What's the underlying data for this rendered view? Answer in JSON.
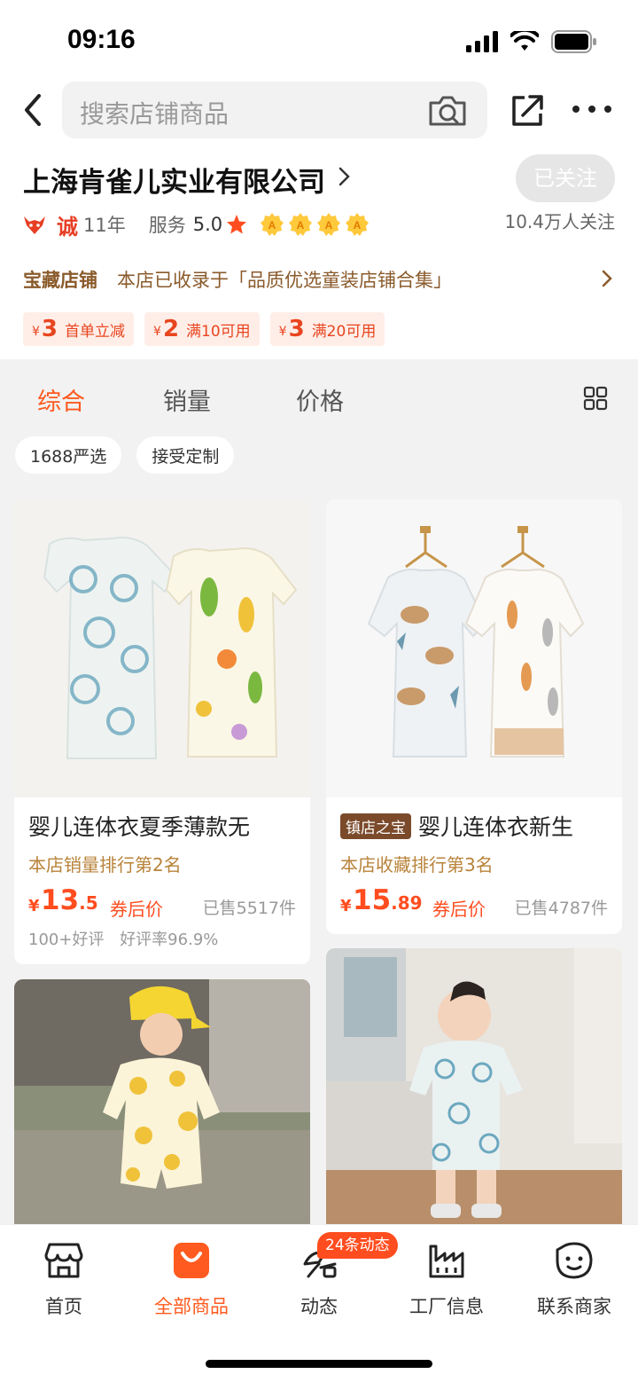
{
  "status_bar": {
    "time": "09:16"
  },
  "search": {
    "placeholder": "搜索店铺商品"
  },
  "shop": {
    "name": "上海肯雀儿实业有限公司",
    "follow_label": "已关注",
    "followers": "10.4万人关注",
    "cheng_label": "诚",
    "years": "11年",
    "service_label": "服务",
    "service_score": "5.0",
    "badge_letter": "A",
    "treasure_label": "宝藏店铺",
    "treasure_desc": "本店已收录于「品质优选童装店铺合集」",
    "coupons": [
      {
        "yen": "¥",
        "amount": "3",
        "cond": "首单立减"
      },
      {
        "yen": "¥",
        "amount": "2",
        "cond": "满10可用"
      },
      {
        "yen": "¥",
        "amount": "3",
        "cond": "满20可用"
      }
    ]
  },
  "sort_tabs": [
    "综合",
    "销量",
    "价格"
  ],
  "filters": [
    "1688严选",
    "接受定制"
  ],
  "products": [
    {
      "title": "婴儿连体衣夏季薄款无",
      "rank": "本店销量排行第2名",
      "price_yen": "¥",
      "price_int": "13",
      "price_dec": ".5",
      "price_tag": "券后价",
      "sold": "已售5517件",
      "reviews": "100+好评",
      "rating": "好评率96.9%"
    },
    {
      "badge": "镇店之宝",
      "title": "婴儿连体衣新生",
      "rank": "本店收藏排行第3名",
      "price_yen": "¥",
      "price_int": "15",
      "price_dec": ".89",
      "price_tag": "券后价",
      "sold": "已售4787件"
    }
  ],
  "bottom_nav": {
    "items": [
      "首页",
      "全部商品",
      "动态",
      "工厂信息",
      "联系商家"
    ],
    "badge": "24条动态"
  },
  "colors": {
    "accent": "#ff5a1f",
    "price": "#ff4d1f",
    "treasure": "#8a5a2b"
  }
}
